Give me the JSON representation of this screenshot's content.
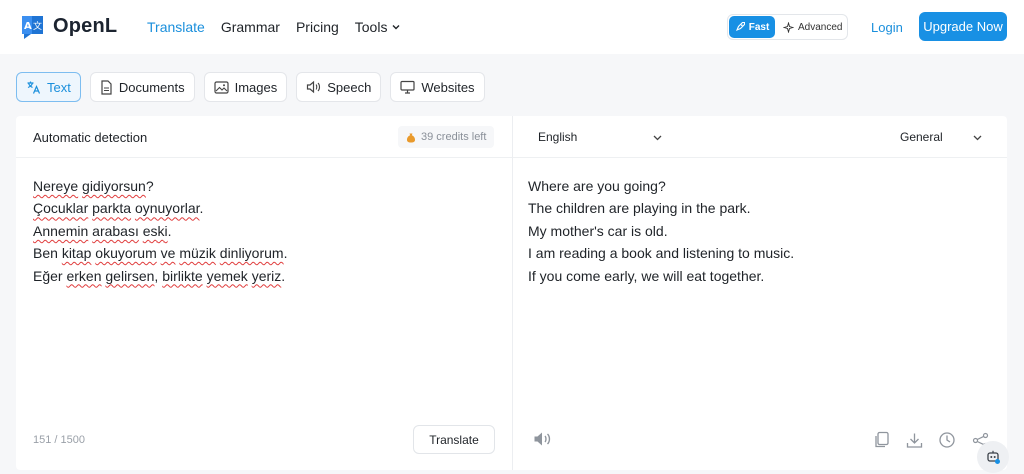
{
  "brand": {
    "name": "OpenL",
    "logo_glyphs": "A文"
  },
  "nav": [
    {
      "label": "Translate",
      "active": true
    },
    {
      "label": "Grammar"
    },
    {
      "label": "Pricing"
    },
    {
      "label": "Tools",
      "has_dropdown": true
    }
  ],
  "modes": {
    "fast_label": "Fast",
    "advanced_label": "Advanced",
    "selected": "Fast"
  },
  "auth": {
    "login_label": "Login",
    "upgrade_label": "Upgrade Now"
  },
  "tabs": [
    {
      "label": "Text",
      "icon": "translate-icon",
      "active": true
    },
    {
      "label": "Documents",
      "icon": "document-icon"
    },
    {
      "label": "Images",
      "icon": "image-icon"
    },
    {
      "label": "Speech",
      "icon": "speaker-icon"
    },
    {
      "label": "Websites",
      "icon": "monitor-icon"
    }
  ],
  "source": {
    "language_label": "Automatic detection",
    "credits_label": "39 credits left",
    "lines": [
      [
        {
          "t": "Nereye",
          "s": true
        },
        {
          "t": " "
        },
        {
          "t": "gidiyorsun",
          "s": true
        },
        {
          "t": "?"
        }
      ],
      [
        {
          "t": "Çocuklar",
          "s": true
        },
        {
          "t": " "
        },
        {
          "t": "parkta",
          "s": true
        },
        {
          "t": " "
        },
        {
          "t": "oynuyorlar",
          "s": true
        },
        {
          "t": "."
        }
      ],
      [
        {
          "t": "Annemin",
          "s": true
        },
        {
          "t": " "
        },
        {
          "t": "arabası",
          "s": true
        },
        {
          "t": " "
        },
        {
          "t": "eski",
          "s": true
        },
        {
          "t": "."
        }
      ],
      [
        {
          "t": "Ben "
        },
        {
          "t": "kitap",
          "s": true
        },
        {
          "t": " "
        },
        {
          "t": "okuyorum",
          "s": true
        },
        {
          "t": " "
        },
        {
          "t": "ve",
          "s": true
        },
        {
          "t": " "
        },
        {
          "t": "müzik",
          "s": true
        },
        {
          "t": " "
        },
        {
          "t": "dinliyorum",
          "s": true
        },
        {
          "t": "."
        }
      ],
      [
        {
          "t": "Eğer "
        },
        {
          "t": "erken",
          "s": true
        },
        {
          "t": " "
        },
        {
          "t": "gelirsen",
          "s": true
        },
        {
          "t": ", "
        },
        {
          "t": "birlikte",
          "s": true
        },
        {
          "t": " "
        },
        {
          "t": "yemek",
          "s": true
        },
        {
          "t": " "
        },
        {
          "t": "yeriz",
          "s": true
        },
        {
          "t": "."
        }
      ]
    ],
    "char_count": "151 / 1500",
    "translate_label": "Translate"
  },
  "target": {
    "language_label": "English",
    "domain_label": "General",
    "lines": [
      "Where are you going?",
      "The children are playing in the park.",
      "My mother's car is old.",
      "I am reading a book and listening to music.",
      "If you come early, we will eat together."
    ]
  },
  "colors": {
    "accent": "#1890e4",
    "link": "#1a8fdc",
    "spellcheck": "#e03c3c"
  }
}
